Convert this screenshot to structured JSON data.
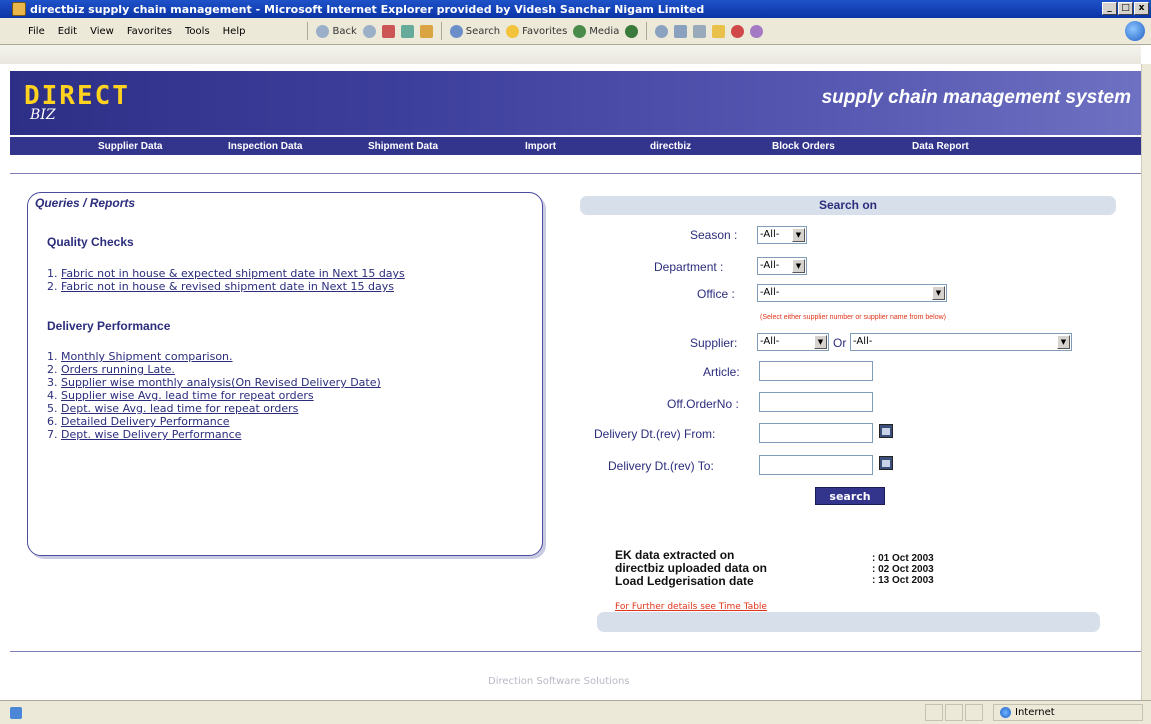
{
  "window": {
    "title": "directbiz supply chain management - Microsoft Internet Explorer provided by Videsh Sanchar Nigam Limited",
    "buttons": [
      "_",
      "□",
      "x"
    ]
  },
  "menu": [
    "File",
    "Edit",
    "View",
    "Favorites",
    "Tools",
    "Help"
  ],
  "toolbar": {
    "back": "Back",
    "search": "Search",
    "favorites": "Favorites",
    "media": "Media"
  },
  "banner": {
    "logo": "DIRECT",
    "logo_sub": "BIZ",
    "tagline": "supply chain management system"
  },
  "nav": [
    "Supplier Data",
    "Inspection Data",
    "Shipment Data",
    "Import",
    "directbiz",
    "Block Orders",
    "Data Report"
  ],
  "queries": {
    "title": "Queries / Reports",
    "quality_heading": "Quality Checks",
    "quality_items": [
      {
        "num": "1.",
        "label": "Fabric not in house & expected shipment date in Next 15 days"
      },
      {
        "num": "2.",
        "label": "Fabric not in house & revised shipment date in Next 15 days"
      }
    ],
    "delivery_heading": "Delivery Performance",
    "delivery_items": [
      {
        "num": "1.",
        "label": "Monthly Shipment comparison."
      },
      {
        "num": "2.",
        "label": "Orders running Late."
      },
      {
        "num": "3.",
        "label": "Supplier wise monthly analysis(On Revised Delivery Date)"
      },
      {
        "num": "4.",
        "label": "Supplier wise Avg. lead time for repeat orders"
      },
      {
        "num": "5.",
        "label": "Dept. wise Avg. lead time for repeat orders"
      },
      {
        "num": "6.",
        "label": "Detailed Delivery Performance"
      },
      {
        "num": "7.",
        "label": "Dept. wise Delivery Performance"
      }
    ]
  },
  "search": {
    "header": "Search on",
    "season_label": "Season :",
    "season_value": "-All-",
    "department_label": "Department :",
    "department_value": "-All-",
    "office_label": "Office :",
    "office_value": "-All-",
    "note": "(Select either supplier number or supplier name from below)",
    "supplier_label": "Supplier:",
    "supplier_value": "-All-",
    "or_label": "Or",
    "supplier_name_value": "-All-",
    "article_label": "Article:",
    "orderno_label": "Off.OrderNo :",
    "from_label": "Delivery Dt.(rev) From:",
    "to_label": "Delivery Dt.(rev) To:",
    "button": "search"
  },
  "info": {
    "row1_label": "EK data extracted on",
    "row1_value": ": 01 Oct 2003",
    "row2_label": "directbiz uploaded data on",
    "row2_value": ": 02 Oct 2003",
    "row3_label": "Load Ledgerisation date",
    "row3_value": ": 13 Oct 2003",
    "link": "For Further details see Time Table"
  },
  "footer": "Direction Software Solutions",
  "status": {
    "zone": "Internet"
  }
}
